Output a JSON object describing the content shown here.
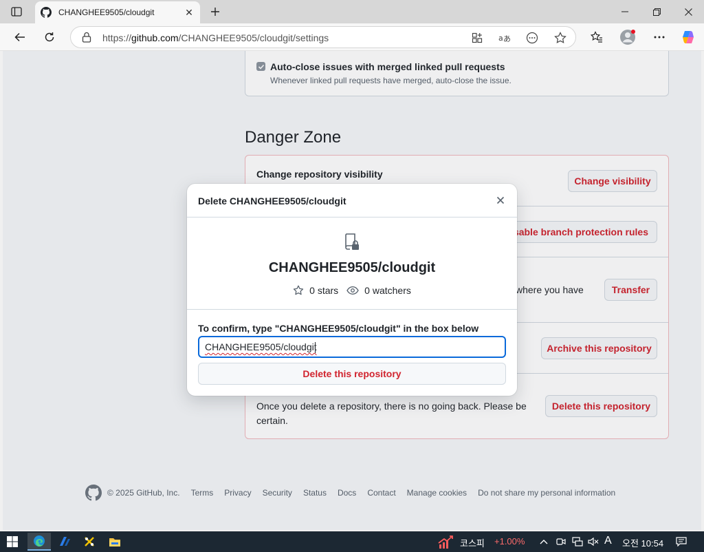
{
  "browser": {
    "tab_title": "CHANGHEE9505/cloudgit",
    "url_prefix": "https://",
    "url_host": "github.com",
    "url_path": "/CHANGHEE9505/cloudgit/settings"
  },
  "settings": {
    "auto_close": {
      "label": "Auto-close issues with merged linked pull requests",
      "description": "Whenever linked pull requests have merged, auto-close the issue.",
      "checked": true
    },
    "danger_zone": {
      "title": "Danger Zone",
      "rows": [
        {
          "heading": "Change repository visibility",
          "button": "Change visibility"
        },
        {
          "button": "Disable branch protection rules"
        },
        {
          "text_fragment": "where you have",
          "button": "Transfer"
        },
        {
          "button": "Archive this repository"
        },
        {
          "text": "Once you delete a repository, there is no going back. Please be certain.",
          "button": "Delete this repository"
        }
      ]
    }
  },
  "modal": {
    "title": "Delete CHANGHEE9505/cloudgit",
    "repo_name": "CHANGHEE9505/cloudgit",
    "stars": "0 stars",
    "watchers": "0 watchers",
    "confirm_label": "To confirm, type \"CHANGHEE9505/cloudgit\" in the box below",
    "input_value": "CHANGHEE9505/cloudgit",
    "delete_button": "Delete this repository"
  },
  "footer": {
    "copyright": "© 2025 GitHub, Inc.",
    "links": [
      "Terms",
      "Privacy",
      "Security",
      "Status",
      "Docs",
      "Contact",
      "Manage cookies",
      "Do not share my personal information"
    ]
  },
  "taskbar": {
    "stock_name": "코스피",
    "stock_change": "+1.00%",
    "ime": "A",
    "clock": "오전 10:54"
  },
  "colors": {
    "danger": "#d1242f",
    "focus": "#0969da",
    "stock_up": "#ff5c5c"
  }
}
